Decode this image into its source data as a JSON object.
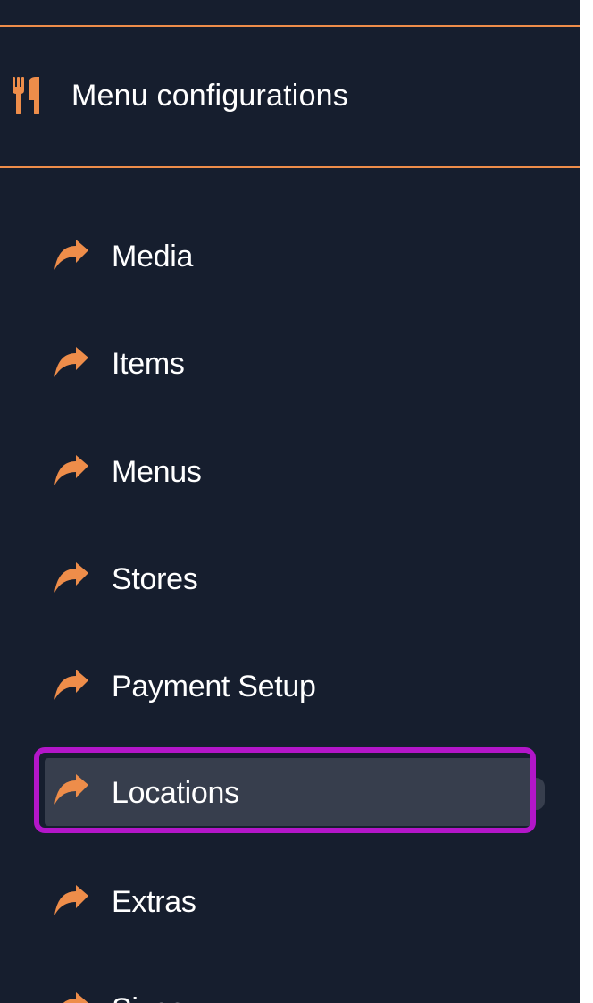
{
  "section": {
    "title": "Menu configurations",
    "icon": "fork-knife-icon",
    "accent_color": "#ee8d4a"
  },
  "nav": {
    "items": [
      {
        "label": "Media",
        "icon": "arrow-forward-icon"
      },
      {
        "label": "Items",
        "icon": "arrow-forward-icon"
      },
      {
        "label": "Menus",
        "icon": "arrow-forward-icon"
      },
      {
        "label": "Stores",
        "icon": "arrow-forward-icon"
      },
      {
        "label": "Payment Setup",
        "icon": "arrow-forward-icon"
      },
      {
        "label": "Locations",
        "icon": "arrow-forward-icon",
        "active": true
      },
      {
        "label": "Extras",
        "icon": "arrow-forward-icon"
      },
      {
        "label": "Sizes",
        "icon": "arrow-forward-icon"
      }
    ]
  },
  "colors": {
    "background": "#161e2e",
    "active_background": "#373e4d",
    "highlight_border": "#b316c9",
    "text": "#ffffff"
  }
}
